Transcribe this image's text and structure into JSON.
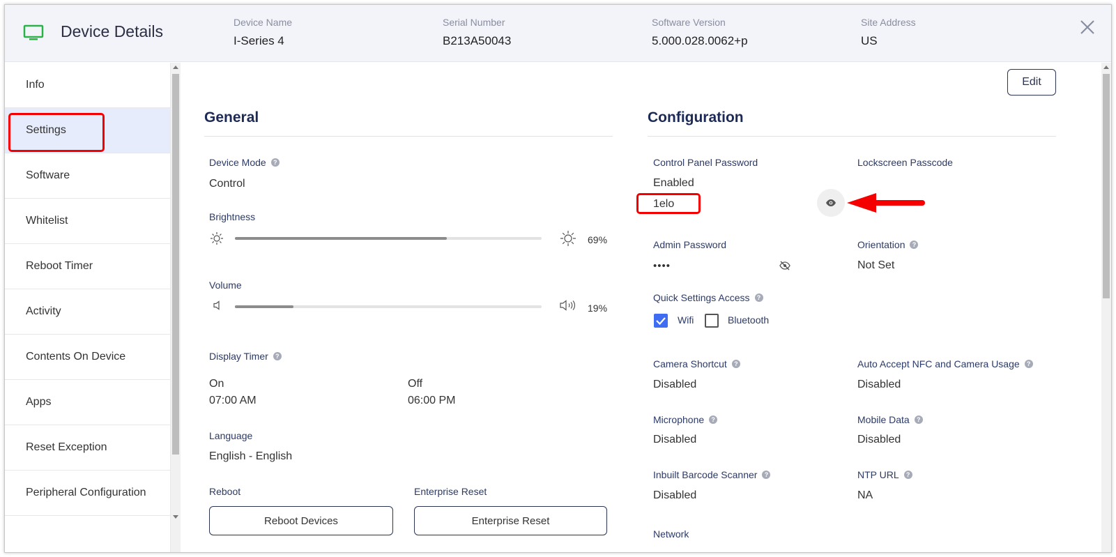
{
  "header": {
    "title": "Device Details",
    "fields": [
      {
        "label": "Device Name",
        "value": "I-Series 4"
      },
      {
        "label": "Serial Number",
        "value": "B213A50043"
      },
      {
        "label": "Software Version",
        "value": "5.000.028.0062+p"
      },
      {
        "label": "Site Address",
        "value": "US"
      }
    ]
  },
  "sidebar": {
    "items": [
      {
        "label": "Info"
      },
      {
        "label": "Settings"
      },
      {
        "label": "Software"
      },
      {
        "label": "Whitelist"
      },
      {
        "label": "Reboot Timer"
      },
      {
        "label": "Activity"
      },
      {
        "label": "Contents On Device"
      },
      {
        "label": "Apps"
      },
      {
        "label": "Reset Exception"
      },
      {
        "label": "Peripheral Configuration"
      }
    ],
    "active_index": 1
  },
  "edit_label": "Edit",
  "general": {
    "title": "General",
    "device_mode": {
      "label": "Device Mode",
      "value": "Control"
    },
    "brightness": {
      "label": "Brightness",
      "percent_text": "69%",
      "level": 0.69
    },
    "volume": {
      "label": "Volume",
      "percent_text": "19%",
      "level": 0.19
    },
    "display_timer": {
      "label": "Display Timer",
      "on_label": "On",
      "on_value": "07:00 AM",
      "off_label": "Off",
      "off_value": "06:00 PM"
    },
    "language": {
      "label": "Language",
      "value": "English - English"
    },
    "reboot": {
      "label": "Reboot",
      "button": "Reboot Devices"
    },
    "enterprise_reset": {
      "label": "Enterprise Reset",
      "button": "Enterprise Reset"
    }
  },
  "configuration": {
    "title": "Configuration",
    "control_panel_password": {
      "label": "Control Panel Password",
      "status": "Enabled",
      "value": "1elo"
    },
    "lockscreen_passcode": {
      "label": "Lockscreen Passcode"
    },
    "admin_password": {
      "label": "Admin Password",
      "value": "••••"
    },
    "orientation": {
      "label": "Orientation",
      "value": "Not Set"
    },
    "quick_settings": {
      "label": "Quick Settings Access",
      "wifi": "Wifi",
      "bluetooth": "Bluetooth",
      "wifi_checked": true,
      "bluetooth_checked": false
    },
    "camera_shortcut": {
      "label": "Camera Shortcut",
      "value": "Disabled"
    },
    "auto_accept": {
      "label": "Auto Accept NFC and Camera Usage",
      "value": "Disabled"
    },
    "microphone": {
      "label": "Microphone",
      "value": "Disabled"
    },
    "mobile_data": {
      "label": "Mobile Data",
      "value": "Disabled"
    },
    "barcode_scanner": {
      "label": "Inbuilt Barcode Scanner",
      "value": "Disabled"
    },
    "ntp_url": {
      "label": "NTP URL",
      "value": "NA"
    },
    "network": {
      "label": "Network"
    }
  },
  "colors": {
    "accent": "#3f6cf0",
    "annotation_red": "#f40000",
    "device_icon_green": "#2bb34a",
    "heading_navy": "#1d2a55"
  }
}
